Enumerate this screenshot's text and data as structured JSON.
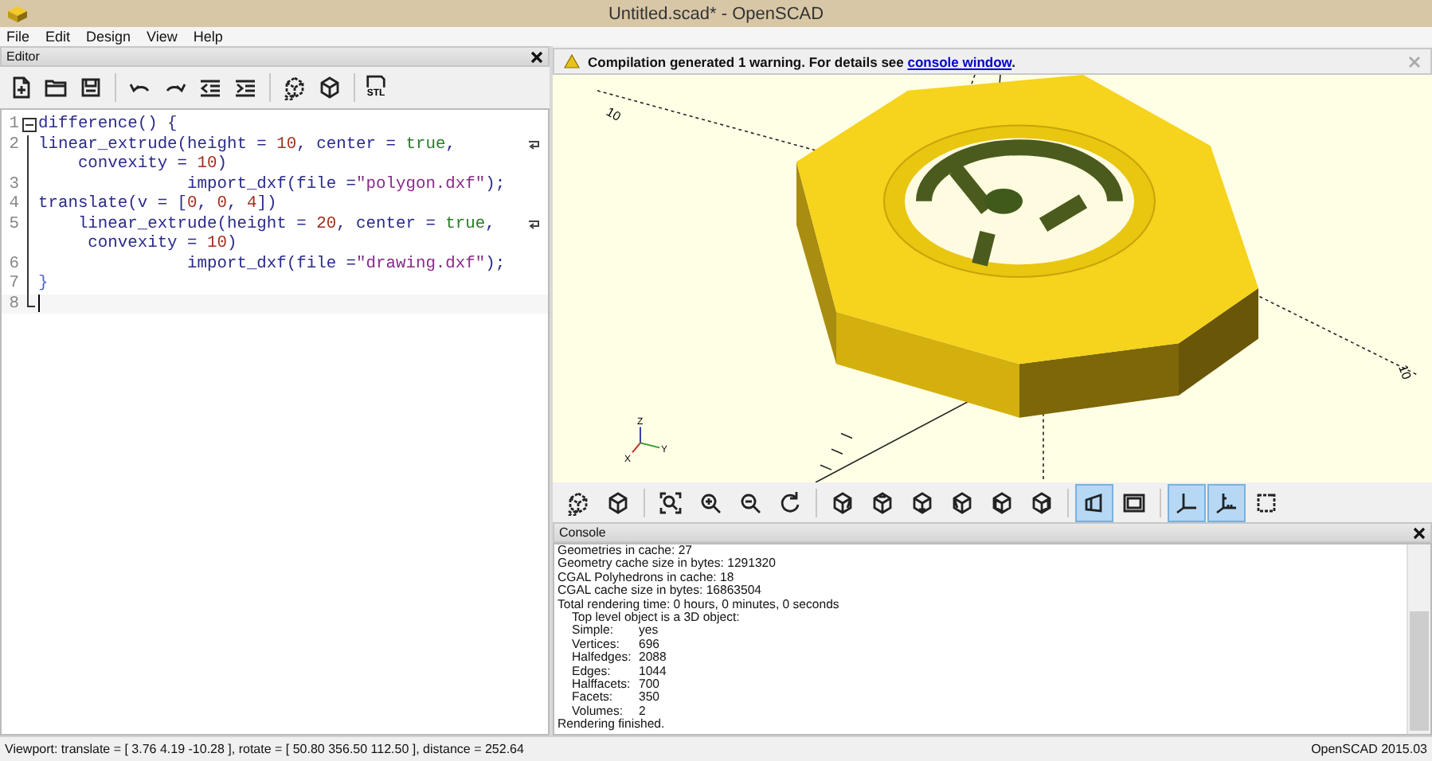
{
  "window": {
    "title": "Untitled.scad* - OpenSCAD"
  },
  "menu": [
    "File",
    "Edit",
    "Design",
    "View",
    "Help"
  ],
  "editor": {
    "title": "Editor",
    "toolbar": [
      [
        {
          "kind": "new"
        },
        {
          "kind": "open"
        },
        {
          "kind": "save"
        }
      ],
      [
        {
          "kind": "undo"
        },
        {
          "kind": "redo"
        },
        {
          "kind": "unindent"
        },
        {
          "kind": "indent"
        }
      ],
      [
        {
          "kind": "preview"
        },
        {
          "kind": "render"
        }
      ],
      [
        {
          "kind": "stl",
          "label": "STL"
        }
      ]
    ],
    "rows": [
      {
        "number": "1",
        "fold": true,
        "wrap": false,
        "current": false,
        "segments": [
          {
            "text": "difference() {",
            "kind": "plain"
          }
        ]
      },
      {
        "number": "2",
        "fold": false,
        "wrap": true,
        "current": false,
        "segments": [
          {
            "text": "linear_extrude(height = ",
            "kind": "plain"
          },
          {
            "text": "10",
            "kind": "number"
          },
          {
            "text": ", center = ",
            "kind": "plain"
          },
          {
            "text": "true",
            "kind": "bool"
          },
          {
            "text": ",",
            "kind": "plain"
          }
        ]
      },
      {
        "fold": false,
        "wrap": false,
        "current": false,
        "segments": [
          {
            "text": "    convexity = ",
            "kind": "plain"
          },
          {
            "text": "10",
            "kind": "number"
          },
          {
            "text": ")",
            "kind": "plain"
          }
        ]
      },
      {
        "number": "3",
        "fold": false,
        "wrap": false,
        "current": false,
        "segments": [
          {
            "text": "               import_dxf(file =",
            "kind": "plain"
          },
          {
            "text": "\"polygon.dxf\"",
            "kind": "string"
          },
          {
            "text": ");",
            "kind": "plain"
          }
        ]
      },
      {
        "number": "4",
        "fold": false,
        "wrap": false,
        "current": false,
        "segments": [
          {
            "text": "translate(v = [",
            "kind": "plain"
          },
          {
            "text": "0",
            "kind": "number"
          },
          {
            "text": ", ",
            "kind": "plain"
          },
          {
            "text": "0",
            "kind": "number"
          },
          {
            "text": ", ",
            "kind": "plain"
          },
          {
            "text": "4",
            "kind": "number"
          },
          {
            "text": "])",
            "kind": "plain"
          }
        ]
      },
      {
        "number": "5",
        "fold": false,
        "wrap": true,
        "current": false,
        "segments": [
          {
            "text": "    linear_extrude(height = ",
            "kind": "plain"
          },
          {
            "text": "20",
            "kind": "number"
          },
          {
            "text": ", center = ",
            "kind": "plain"
          },
          {
            "text": "true",
            "kind": "bool"
          },
          {
            "text": ",",
            "kind": "plain"
          }
        ]
      },
      {
        "fold": false,
        "wrap": false,
        "current": false,
        "segments": [
          {
            "text": "     convexity = ",
            "kind": "plain"
          },
          {
            "text": "10",
            "kind": "number"
          },
          {
            "text": ")",
            "kind": "plain"
          }
        ]
      },
      {
        "number": "6",
        "fold": false,
        "wrap": false,
        "current": false,
        "segments": [
          {
            "text": "               import_dxf(file =",
            "kind": "plain"
          },
          {
            "text": "\"drawing.dxf\"",
            "kind": "string"
          },
          {
            "text": ");",
            "kind": "plain"
          }
        ]
      },
      {
        "number": "7",
        "fold": false,
        "wrap": false,
        "current": false,
        "segments": [
          {
            "text": "}",
            "kind": "brace"
          }
        ]
      },
      {
        "number": "8",
        "fold": false,
        "wrap": false,
        "current": true,
        "segments": []
      }
    ]
  },
  "warning": {
    "message": "Compilation generated 1 warning. For details see ",
    "link": "console window",
    "end": "."
  },
  "viewport": {
    "axis_labels": [
      "10",
      "10"
    ],
    "indicator_labels": [
      "Z",
      "Y",
      "X"
    ],
    "toolbar": [
      [
        {
          "kind": "preview",
          "on": false
        },
        {
          "kind": "render",
          "on": false
        }
      ],
      [
        {
          "kind": "view-all",
          "on": false
        },
        {
          "kind": "zoom-in",
          "on": false
        },
        {
          "kind": "zoom-out",
          "on": false
        },
        {
          "kind": "reset",
          "on": false
        }
      ],
      [
        {
          "kind": "right",
          "on": false
        },
        {
          "kind": "top",
          "on": false
        },
        {
          "kind": "bottom",
          "on": false
        },
        {
          "kind": "left",
          "on": false
        },
        {
          "kind": "front",
          "on": false
        },
        {
          "kind": "back",
          "on": false
        }
      ],
      [
        {
          "kind": "perspective",
          "on": true
        },
        {
          "kind": "orthogonal",
          "on": false
        }
      ],
      [
        {
          "kind": "axes",
          "on": true
        },
        {
          "kind": "scale",
          "on": true
        },
        {
          "kind": "edges",
          "on": false
        }
      ]
    ]
  },
  "console": {
    "title": "Console",
    "lines": [
      {
        "kind": "text",
        "text": "Geometries in cache: 27"
      },
      {
        "kind": "text",
        "text": "Geometry cache size in bytes: 1291320"
      },
      {
        "kind": "text",
        "text": "CGAL Polyhedrons in cache: 18"
      },
      {
        "kind": "text",
        "text": "CGAL cache size in bytes: 16863504"
      },
      {
        "kind": "text",
        "text": "Total rendering time: 0 hours, 0 minutes, 0 seconds"
      },
      {
        "kind": "indent",
        "text": "Top level object is a 3D object:"
      },
      {
        "kind": "stat",
        "label": "Simple:",
        "value": "yes"
      },
      {
        "kind": "stat",
        "label": "Vertices:",
        "value": "696"
      },
      {
        "kind": "stat",
        "label": "Halfedges:",
        "value": "2088"
      },
      {
        "kind": "stat",
        "label": "Edges:",
        "value": "1044"
      },
      {
        "kind": "stat",
        "label": "Halffacets:",
        "value": "700"
      },
      {
        "kind": "stat",
        "label": "Facets:",
        "value": "350"
      },
      {
        "kind": "stat",
        "label": "Volumes:",
        "value": "2"
      },
      {
        "kind": "text",
        "text": "Rendering finished."
      }
    ]
  },
  "status_bar": {
    "viewport": "Viewport: translate = [ 3.76 4.19 -10.28 ], rotate = [ 50.80 356.50 112.50 ], distance = 252.64",
    "version": "OpenSCAD 2015.03"
  }
}
